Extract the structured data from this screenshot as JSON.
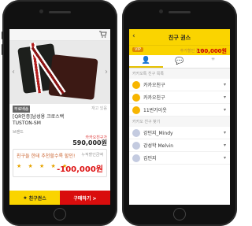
{
  "product": {
    "badge_free": "무료배송",
    "badge_stock": "재고 있음",
    "name_line1": "[QR인증]남성용 크로스백",
    "name_line2": "TUSTON-SM",
    "brand": "브랜드",
    "price_label": "카카오친구가",
    "price": "590,000원",
    "coupon_handwriting": "친구들 한테 추천할수록 할인!",
    "coupon_accum_label": "누적할인금액",
    "coupon_stars": "★ ★ ★ ★ ★",
    "discount": "-100,000원",
    "btn_recommend": "친구권스",
    "btn_buy": "구매하기 >"
  },
  "recommend": {
    "title": "친구 권스",
    "vip_label": "VIP",
    "total_label": "추가할인 금액",
    "total_value": "100,000원",
    "tabs": [
      {
        "icon": "person-icon",
        "glyph": "👤"
      },
      {
        "icon": "chat-icon",
        "glyph": "💬"
      },
      {
        "icon": "quote-icon",
        "glyph": "❞"
      }
    ],
    "section_kakao": "카카오톡 친구 목록",
    "friends_kakao": [
      "카카오친구",
      "카카오친구",
      "11번가이웃"
    ],
    "section_other": "카카오 친구 찾기",
    "friends_other": [
      "강민지_Mindy",
      "강성학 Melvin",
      "김민지"
    ]
  }
}
